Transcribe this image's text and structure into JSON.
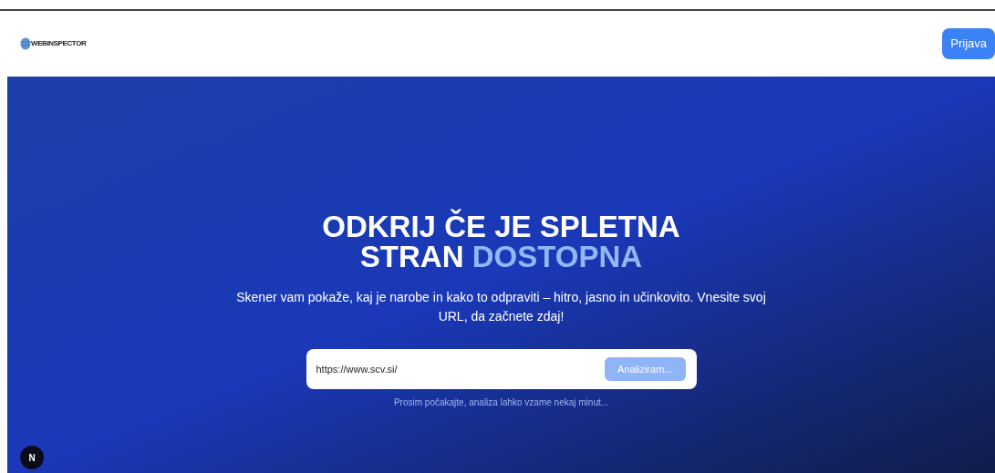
{
  "header": {
    "logo_text": "WEBINSPECTOR",
    "login_button": "Prijava"
  },
  "hero": {
    "title_parts": [
      {
        "text": "ODKRIJ ČE JE SPLETNA STRAN",
        "highlight": false
      },
      {
        "text": "DOSTOPNA",
        "highlight": true
      }
    ],
    "subtitle": "Skener vam pokaže, kaj je narobe in kako to odpraviti – hitro, jasno in učinkovito. Vnesite svoj URL, da začnete zdaj!",
    "url_field": {
      "value": "https://www.scv.si/"
    },
    "analyze_button": {
      "label": "Analiziram...",
      "disabled": true
    },
    "status_message": "Prosim počakajte, analiza lahko vzame nekaj minut..."
  },
  "dev_badge": {
    "letter": "N"
  }
}
